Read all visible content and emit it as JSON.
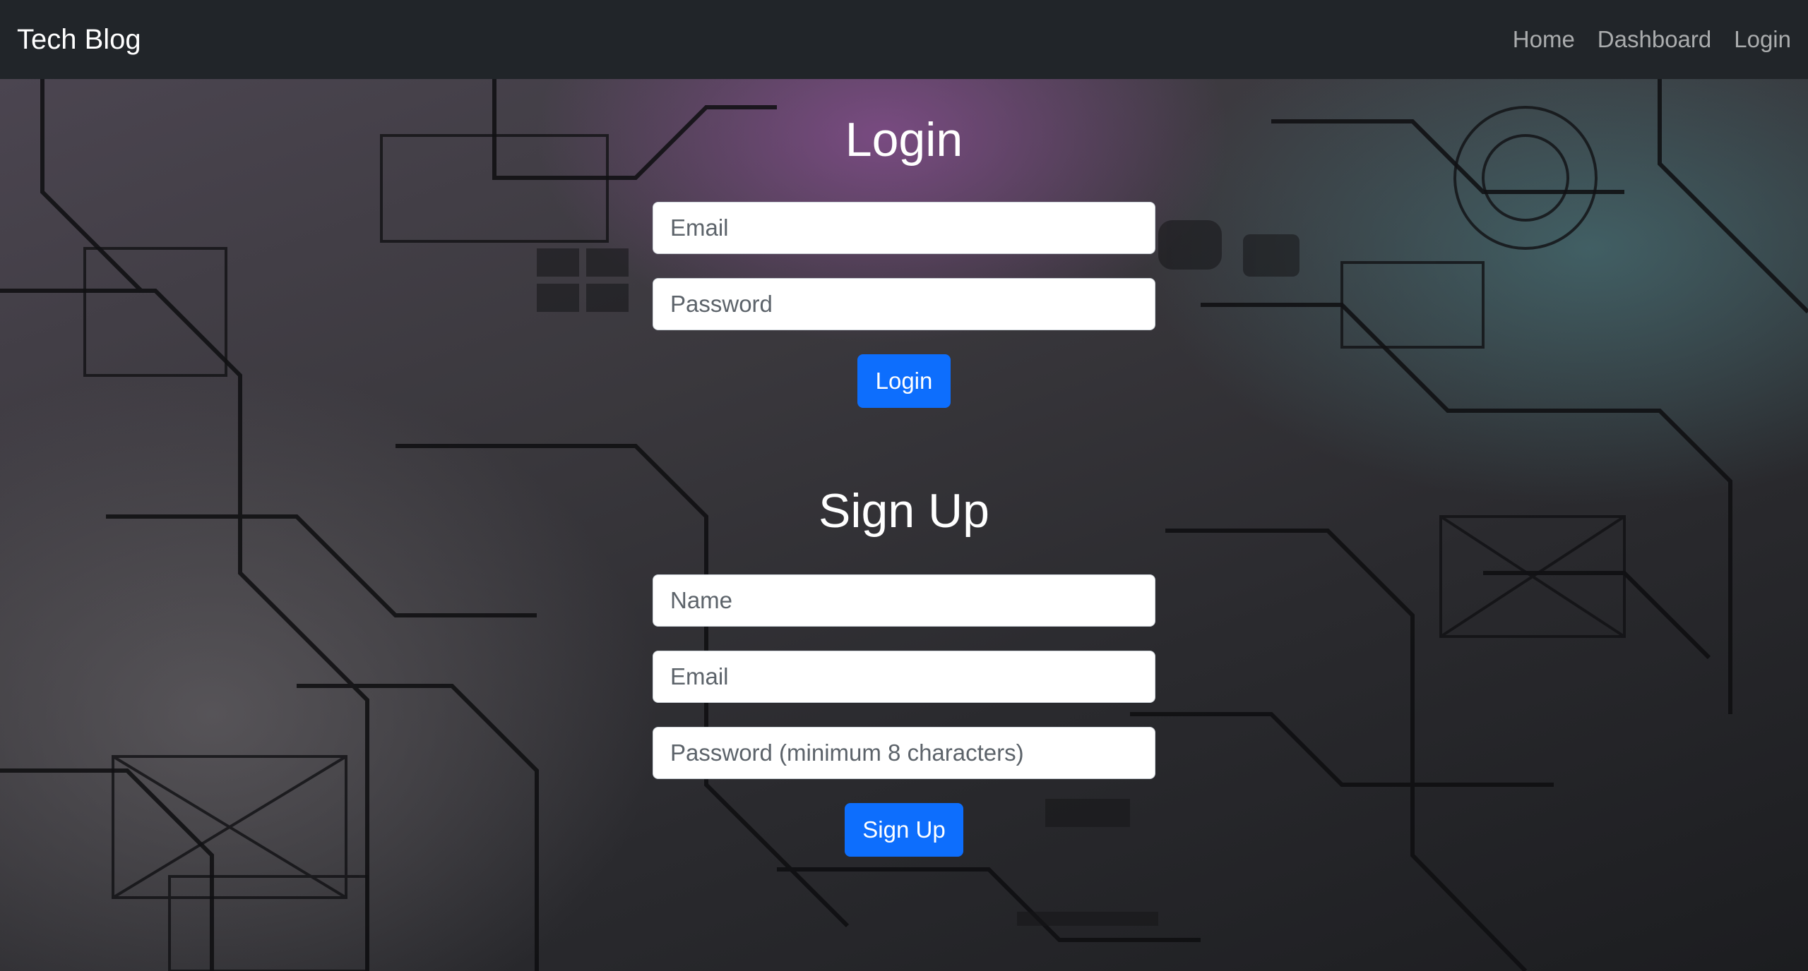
{
  "navbar": {
    "brand": "Tech Blog",
    "links": [
      "Home",
      "Dashboard",
      "Login"
    ]
  },
  "login": {
    "title": "Login",
    "email_placeholder": "Email",
    "password_placeholder": "Password",
    "button_label": "Login"
  },
  "signup": {
    "title": "Sign Up",
    "name_placeholder": "Name",
    "email_placeholder": "Email",
    "password_placeholder": "Password (minimum 8 characters)",
    "button_label": "Sign Up"
  },
  "colors": {
    "navbar_bg": "#212529",
    "primary_button": "#0d6efd"
  }
}
